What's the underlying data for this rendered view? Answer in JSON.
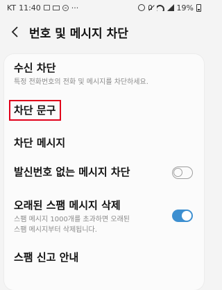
{
  "status_bar": {
    "carrier": "KT",
    "time": "11:40",
    "more": "···",
    "battery": "19%"
  },
  "header": {
    "title": "번호 및 메시지 차단"
  },
  "settings": {
    "receive_block": {
      "title": "수신 차단",
      "subtitle": "특정 전화번호의 전화 및 메시지를 차단하세요."
    },
    "block_phrase": {
      "title": "차단 문구"
    },
    "blocked_messages": {
      "title": "차단 메시지"
    },
    "no_caller_id": {
      "title": "발신번호 없는 메시지 차단",
      "enabled": false
    },
    "delete_old_spam": {
      "title": "오래된 스팸 메시지 삭제",
      "subtitle_line1": "스팸 메시지 1000개를 초과하면 오래된",
      "subtitle_line2": "스팸 메시지부터 삭제됩니다.",
      "enabled": true
    },
    "spam_report": {
      "title": "스팸 신고 안내"
    }
  },
  "colors": {
    "highlight_box": "#e1001a",
    "toggle_on": "#3d8fd0"
  }
}
